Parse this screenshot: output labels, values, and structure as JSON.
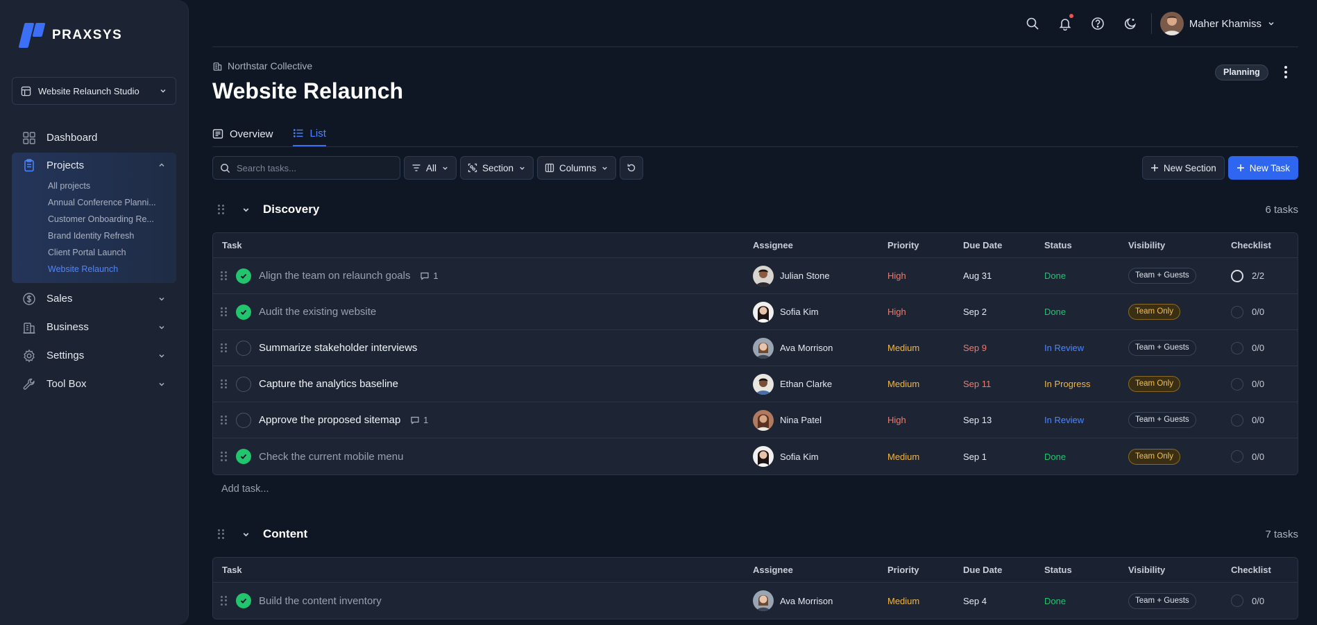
{
  "brand": {
    "name": "PRAXSYS"
  },
  "workspace": {
    "label": "Website Relaunch Studio"
  },
  "sidebar": {
    "dashboard": "Dashboard",
    "projects": "Projects",
    "project_items": [
      "All projects",
      "Annual Conference Planni...",
      "Customer Onboarding Re...",
      "Brand Identity Refresh",
      "Client Portal Launch",
      "Website Relaunch"
    ],
    "sales": "Sales",
    "business": "Business",
    "settings": "Settings",
    "toolbox": "Tool Box"
  },
  "topbar": {
    "user_name": "Maher Khamiss"
  },
  "header": {
    "org": "Northstar Collective",
    "title": "Website Relaunch",
    "status_badge": "Planning"
  },
  "tabs": [
    {
      "label": "Overview"
    },
    {
      "label": "List"
    }
  ],
  "toolbar": {
    "search_placeholder": "Search tasks...",
    "filter_label": "All",
    "section_label": "Section",
    "columns_label": "Columns",
    "new_section": "New Section",
    "new_task": "New Task"
  },
  "columns": {
    "task": "Task",
    "assignee": "Assignee",
    "priority": "Priority",
    "due": "Due Date",
    "status": "Status",
    "visibility": "Visibility",
    "checklist": "Checklist"
  },
  "sections": [
    {
      "title": "Discovery",
      "count": "6 tasks",
      "add_task": "Add task...",
      "tasks": [
        {
          "title": "Align the team on relaunch goals",
          "done": true,
          "comments": "1",
          "assignee": "Julian Stone",
          "priority": "High",
          "due": "Aug 31",
          "status": "Done",
          "visibility": "Team + Guests",
          "checklist": "2/2"
        },
        {
          "title": "Audit the existing website",
          "done": true,
          "comments": "",
          "assignee": "Sofia Kim",
          "priority": "High",
          "due": "Sep 2",
          "status": "Done",
          "visibility": "Team Only",
          "checklist": "0/0"
        },
        {
          "title": "Summarize stakeholder interviews",
          "done": false,
          "comments": "",
          "assignee": "Ava Morrison",
          "priority": "Medium",
          "due": "Sep 9",
          "status": "In Review",
          "visibility": "Team + Guests",
          "checklist": "0/0"
        },
        {
          "title": "Capture the analytics baseline",
          "done": false,
          "comments": "",
          "assignee": "Ethan Clarke",
          "priority": "Medium",
          "due": "Sep 11",
          "status": "In Progress",
          "visibility": "Team Only",
          "checklist": "0/0"
        },
        {
          "title": "Approve the proposed sitemap",
          "done": false,
          "comments": "1",
          "assignee": "Nina Patel",
          "priority": "High",
          "due": "Sep 13",
          "status": "In Review",
          "visibility": "Team + Guests",
          "checklist": "0/0"
        },
        {
          "title": "Check the current mobile menu",
          "done": true,
          "comments": "",
          "assignee": "Sofia Kim",
          "priority": "Medium",
          "due": "Sep 1",
          "status": "Done",
          "visibility": "Team Only",
          "checklist": "0/0"
        }
      ]
    },
    {
      "title": "Content",
      "count": "7 tasks",
      "tasks": [
        {
          "title": "Build the content inventory",
          "done": true,
          "comments": "",
          "assignee": "Ava Morrison",
          "priority": "Medium",
          "due": "Sep 4",
          "status": "Done",
          "visibility": "Team + Guests",
          "checklist": "0/0"
        }
      ]
    }
  ],
  "colors": {
    "accent": "#2f66f0",
    "done": "#22c56e",
    "high": "#f07a6a",
    "medium": "#f3b63f",
    "review": "#4d86ff"
  }
}
